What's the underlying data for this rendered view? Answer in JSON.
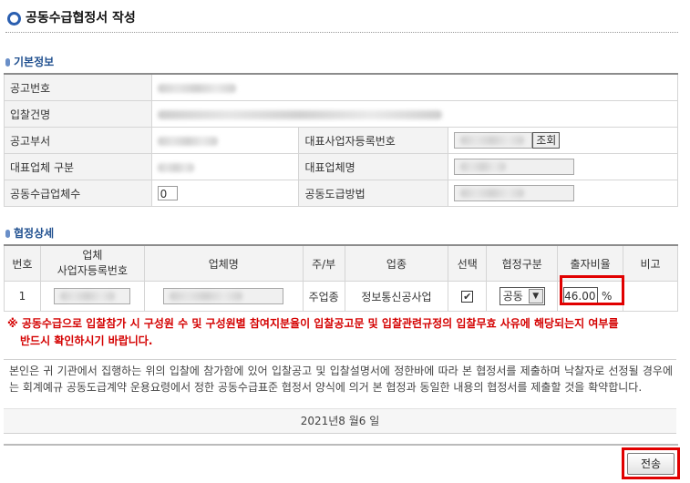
{
  "page_title": "공동수급협정서 작성",
  "basic_info": {
    "section_title": "기본정보",
    "labels": {
      "notice_no": "공고번호",
      "bid_name": "입찰건명",
      "notice_dept": "공고부서",
      "rep_biz_no": "대표사업자등록번호",
      "lead_type": "대표업체 구분",
      "lead_name": "대표업체명",
      "member_count": "공동수급업체수",
      "joint_method": "공동도급방법"
    },
    "member_count_value": "0",
    "lookup_button": "조회"
  },
  "detail": {
    "section_title": "협정상세",
    "headers": [
      "번호",
      "업체\n사업자등록번호",
      "업체명",
      "주/부",
      "업종",
      "선택",
      "협정구분",
      "출자비율",
      "비고"
    ],
    "rows": [
      {
        "no": "1",
        "role": "주업종",
        "industry": "정보통신공사업",
        "selected": "✔",
        "agreement_type": "공동",
        "ratio": "46.00",
        "ratio_unit": "%",
        "note": ""
      }
    ]
  },
  "warning": {
    "line1": "※ 공동수급으로 입찰참가 시 구성원 수 및 구성원별 참여지분율이 입찰공고문 및 입찰관련규정의 입찰무효 사유에 해당되는지 여부를",
    "line2": "반드시 확인하시기 바랍니다."
  },
  "agreement": {
    "text": "본인은 귀 기관에서 집행하는 위의 입찰에 참가함에 있어 입찰공고 및 입찰설명서에 정한바에 따라 본 협정서를 제출하며 낙찰자로 선정될 경우에는 회계예규 공동도급계약 운용요령에서 정한 공동수급표준 협정서 양식에 의거 본 협정과 동일한 내용의 협정서를 제출할 것을 확약합니다.",
    "date": "2021년8 월6 일"
  },
  "send_button": "전송",
  "colors": {
    "accent": "#2b5fb0",
    "highlight": "#e10000",
    "warning_text": "#d40000"
  }
}
